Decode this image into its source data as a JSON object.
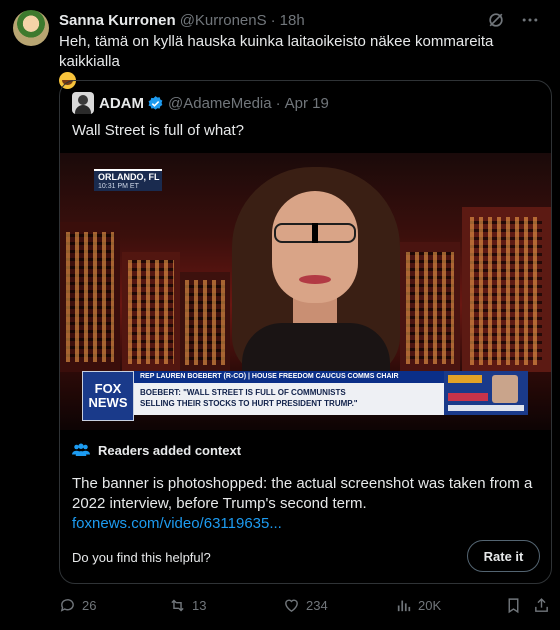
{
  "tweet": {
    "name": "Sanna Kurronen",
    "handle": "@KurronenS",
    "separator": "·",
    "time": "18h",
    "text": "Heh, tämä on kyllä hauska kuinka laitaoikeisto näkee kommareita kaikkialla",
    "emoji_icon": "grinning-face-emoji"
  },
  "quoted": {
    "name": "ADAM",
    "handle": "@AdameMedia",
    "separator": "·",
    "date": "Apr 19",
    "text": "Wall Street is full of what?",
    "media": {
      "location_city": "ORLANDO, FL",
      "location_time": "10:31 PM ET",
      "logo_line1": "FOX",
      "logo_line2": "NEWS",
      "chyron_top": "REP LAUREN BOEBERT (R-CO) | HOUSE FREEDOM CAUCUS COMMS CHAIR",
      "chyron_line1": "BOEBERT: \"WALL STREET IS FULL OF COMMUNISTS",
      "chyron_line2": "SELLING THEIR STOCKS TO HURT PRESIDENT TRUMP.\""
    }
  },
  "context": {
    "heading": "Readers added context",
    "body": "The banner is photoshopped: the actual screenshot was taken from a 2022 interview, before Trump's second term.",
    "link": "foxnews.com/video/63119635...",
    "helpful_prompt": "Do you find this helpful?",
    "rate_label": "Rate it"
  },
  "actions": {
    "replies": "26",
    "reposts": "13",
    "likes": "234",
    "views": "20K"
  },
  "colors": {
    "background": "#000000",
    "text": "#e7e9ea",
    "muted": "#71767b",
    "accent": "#1d9bf0",
    "border": "#2f3336"
  }
}
